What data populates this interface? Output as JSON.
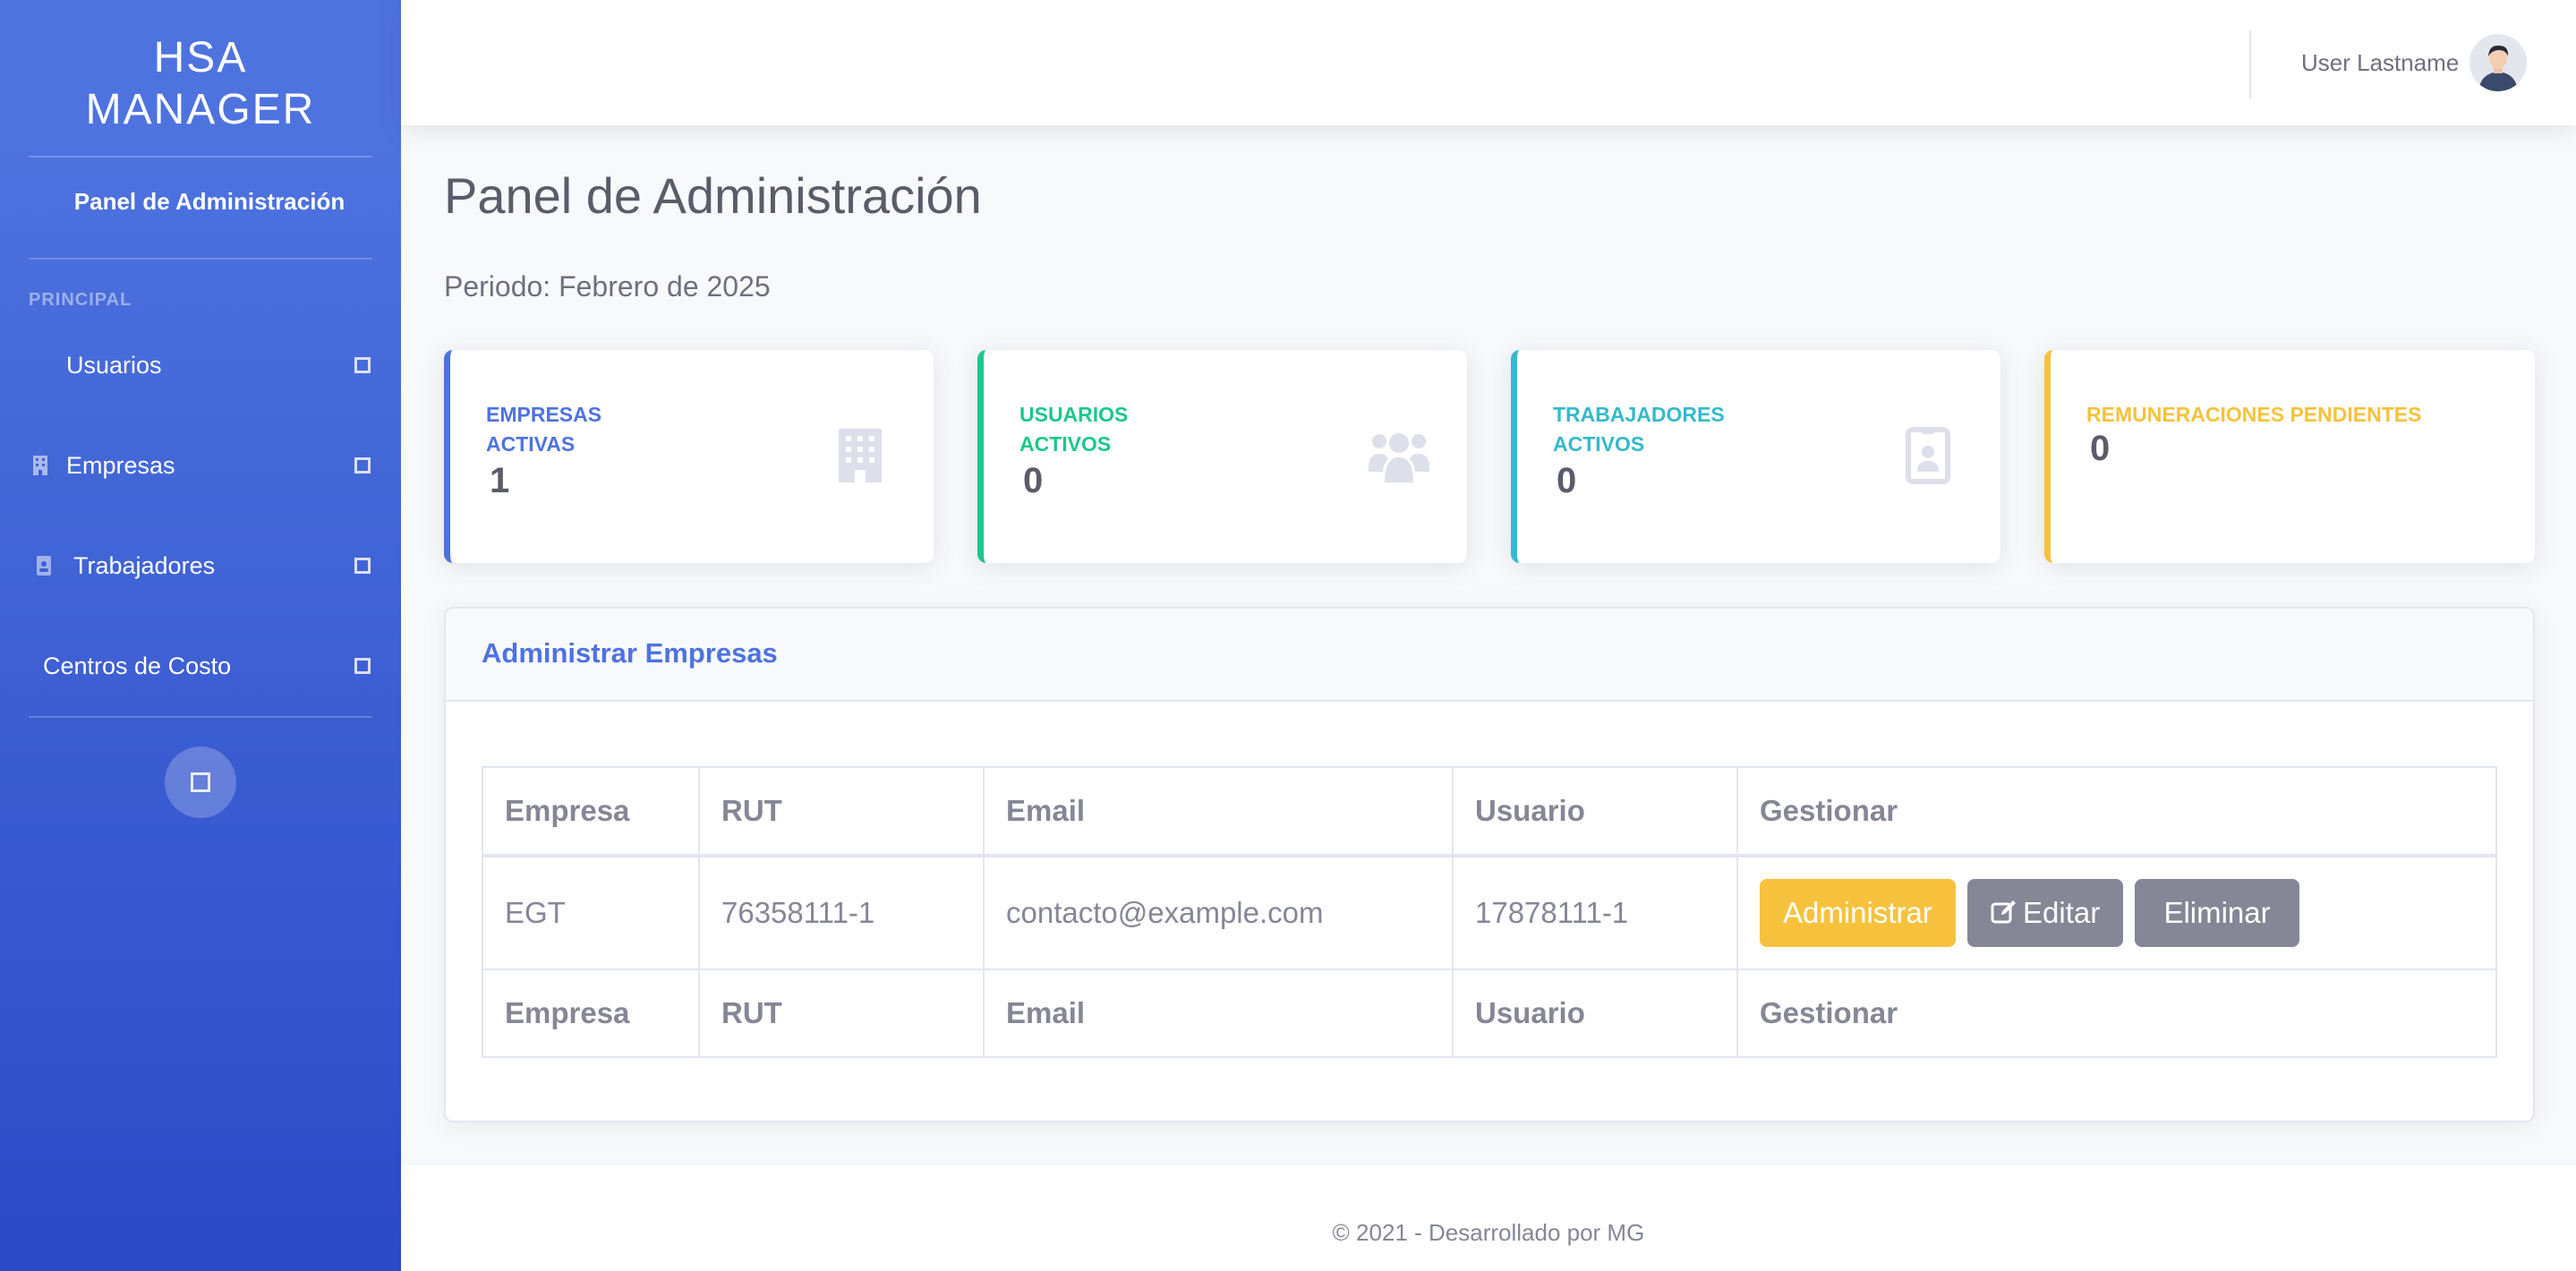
{
  "sidebar": {
    "brand": "HSA\nMANAGER",
    "brand_line1": "HSA",
    "brand_line2": "MANAGER",
    "dashboard": "Panel de Administración",
    "heading": "PRINCIPAL",
    "items": [
      {
        "label": "Usuarios",
        "icon": "none"
      },
      {
        "label": "Empresas",
        "icon": "building-icon"
      },
      {
        "label": "Trabajadores",
        "icon": "id-badge-icon"
      },
      {
        "label": "Centros de Costo",
        "icon": "none"
      }
    ],
    "toggler_icon": "square-icon"
  },
  "topbar": {
    "user_name": "User Lastname",
    "avatar_icon": "user-avatar"
  },
  "main": {
    "title": "Panel de Administración",
    "period": "Periodo: Febrero de 2025",
    "cards": [
      {
        "label": "EMPRESAS ACTIVAS",
        "value": "1",
        "icon": "building-icon",
        "color": "#4e73df"
      },
      {
        "label": "USUARIOS ACTIVOS",
        "value": "0",
        "icon": "users-icon",
        "color": "#1cc88a"
      },
      {
        "label": "TRABAJADORES ACTIVOS",
        "value": "0",
        "icon": "id-badge-icon",
        "color": "#36b9cc"
      },
      {
        "label": "REMUNERACIONES PENDIENTES",
        "value": "0",
        "icon": "none",
        "color": "#f6c23e"
      }
    ],
    "panel": {
      "title": "Administrar Empresas",
      "columns": [
        "Empresa",
        "RUT",
        "Email",
        "Usuario",
        "Gestionar"
      ],
      "rows": [
        {
          "empresa": "EGT",
          "rut": "76358111-1",
          "email": "contacto@example.com",
          "usuario": "17878111-1"
        }
      ],
      "buttons": {
        "administrar": "Administrar",
        "editar": "Editar",
        "eliminar": "Eliminar"
      }
    }
  },
  "footer": {
    "text": "© 2021 - Desarrollado por MG"
  }
}
